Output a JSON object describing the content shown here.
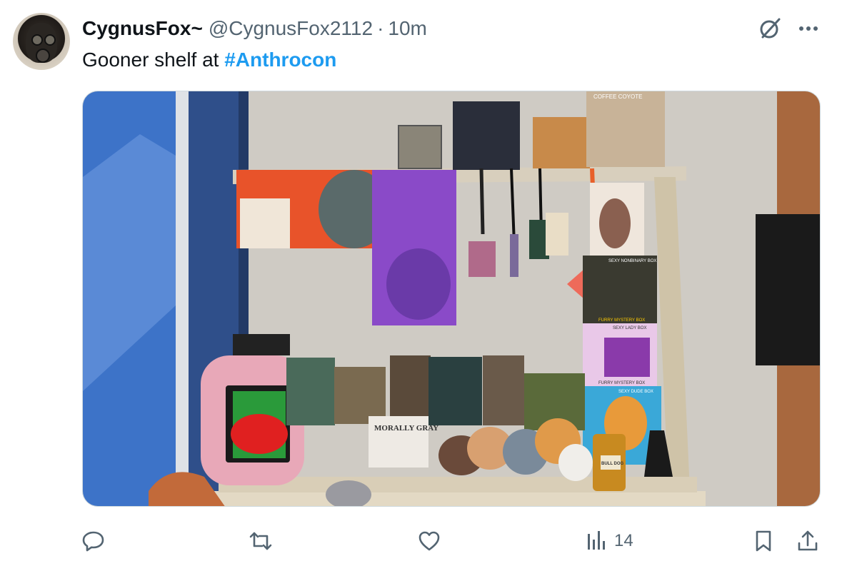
{
  "author": {
    "display_name": "CygnusFox~",
    "handle": "@CygnusFox2112",
    "separator": "·",
    "time": "10m"
  },
  "tweet": {
    "text": "Gooner shelf at ",
    "hashtag": "#Anthrocon"
  },
  "media": {
    "alt": "Photo of a shelf with art prints, lanyards, books, plushies and mystery boxes",
    "labels": {
      "coffee_coyote": "COFFEE COYOTE",
      "nonbinary_box": "SEXY NONBINARY BOX",
      "furry_mystery_1": "FURRY MYSTERY BOX",
      "lady_box": "SEXY LADY BOX",
      "furry_mystery_2": "FURRY MYSTERY BOX",
      "dude_box": "SEXY DUDE BOX",
      "book": "MORALLY GRAY",
      "bottle": "BULL DOG"
    }
  },
  "actions": {
    "reply_label": "Reply",
    "repost_label": "Repost",
    "like_label": "Like",
    "views_count": "14",
    "bookmark_label": "Bookmark",
    "share_label": "Share"
  },
  "icons": [
    "grok-icon",
    "more-icon",
    "reply-icon",
    "repost-icon",
    "like-icon",
    "views-icon",
    "bookmark-icon",
    "share-icon"
  ],
  "colors": {
    "accent": "#1d9bf0",
    "secondary_text": "#536471",
    "primary_text": "#0f1419"
  }
}
